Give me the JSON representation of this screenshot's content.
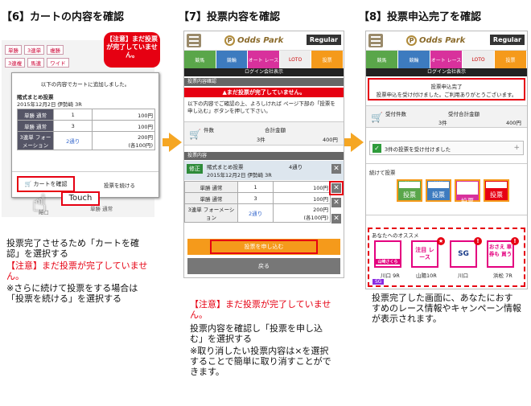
{
  "titles": {
    "s6": "【6】カートの内容を確認",
    "s7": "【7】投票内容を確認",
    "s8": "【8】投票申込完了を確認"
  },
  "app": {
    "logo": "Odds Park",
    "regular": "Regular",
    "tabs": [
      "競馬",
      "競輪",
      "オート レース",
      "LOTO",
      "投票"
    ]
  },
  "s6": {
    "filters": [
      "単勝",
      "3連単",
      "複勝",
      "3連複",
      "馬連",
      "ワイド"
    ],
    "notice": "【注意】まだ投票が完了していません。",
    "intro": "以下の内容でカートに追加しました。",
    "race_name": "賭式まとめ投票",
    "race_date": "2015年12月2日 伊勢崎 3R",
    "rows": [
      {
        "type": "単勝 通常",
        "num": "1",
        "amount": "100円"
      },
      {
        "type": "単勝 通常",
        "num": "3",
        "amount": "100円"
      },
      {
        "type": "3連単 フォーメーション",
        "num": "2通り",
        "amount": "200円",
        "sub": "(各100円)"
      }
    ],
    "cart_btn": "カートを確認",
    "continue_btn": "投票を続ける",
    "touch": "Touch",
    "desc1": "投票完了させるため「カートを確認」を選択する",
    "desc2": "【注意】まだ投票が完了していません。",
    "desc3": "※さらに続けて投票をする場合は「投票を続ける」を選択する",
    "bg_labels": [
      "給□",
      "単勝",
      "単勝 通常"
    ]
  },
  "s7": {
    "loginbar": "ログイン会社表示",
    "confirm_bar": "投票内容確認",
    "warning": "▲まだ投票が完了していません。",
    "instruction": "以下の内容でご確認の上、よろしければ ページ下部の「投票を申し込む」ボタンを押して下さい。",
    "count_label": "件数",
    "count_val": "3件",
    "total_label": "合計金額",
    "total_val": "400円",
    "detail_bar": "投票内容",
    "tag": "修正",
    "race_name": "賭式まとめ投票",
    "race_count": "4通り",
    "race_date": "2015年12月2日 伊勢崎 3R",
    "rows": [
      {
        "type": "単勝 通常",
        "num": "1",
        "amount": "100円"
      },
      {
        "type": "単勝 通常",
        "num": "3",
        "amount": "100円"
      },
      {
        "type": "3連単 フォーメーション",
        "num": "2通り",
        "amount": "200円",
        "sub": "(各100円)"
      }
    ],
    "submit_btn": "投票を申し込む",
    "back_btn": "戻る",
    "desc1": "【注意】まだ投票が完了していません。",
    "desc2": "投票内容を確認し「投票を申し込む」を選択する",
    "desc3": "※取り消したい投票内容は×を選択することで簡単に取り消すことができます。"
  },
  "s8": {
    "loginbar": "ログイン会社表示",
    "complete_title": "投票申込完了",
    "complete_msg": "投票申込を受け付けました。ご利用ありがとうございます。",
    "accept_count_label": "受付件数",
    "accept_count_val": "3件",
    "accept_total_label": "受付合計金額",
    "accept_total_val": "400円",
    "accepted": "3件の投票を受け付けました",
    "continue_label": "続けて投票",
    "vote_btns": [
      {
        "label": "競馬",
        "sub": "投票",
        "color": "#5aa64a"
      },
      {
        "label": "競輪",
        "sub": "投票",
        "color": "#3d7bbf"
      },
      {
        "label": "オート レース",
        "sub": "投票",
        "color": "#d8319c"
      },
      {
        "label": "LOTO",
        "sub": "投票",
        "color": "#e60012"
      }
    ],
    "rec_title": "あなたへのオススメ",
    "recs": [
      {
        "label": "山崎さくら",
        "sub": "川口 9R"
      },
      {
        "label": "注目 レース",
        "sub": "山陽10R"
      },
      {
        "label": "SG",
        "sub": "川口"
      },
      {
        "label": "おさえ 車券も 買う",
        "sub": "浜松 7R"
      }
    ],
    "sg": "SG",
    "desc": "投票完了した画面に、あなたにおすすめのレース情報やキャンペーン情報が表示されます。"
  }
}
